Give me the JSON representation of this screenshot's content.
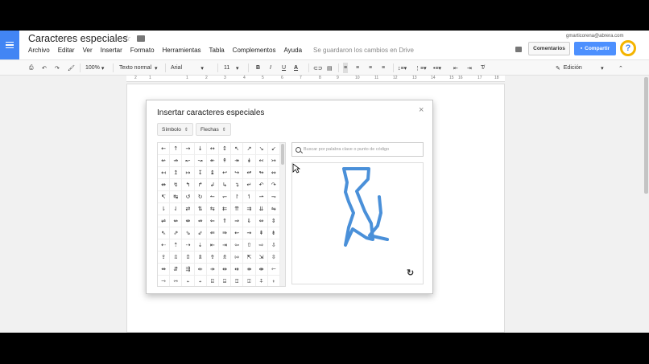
{
  "app": {
    "doc_title": "Caracteres especiales",
    "user_email": "gmarticorena@abrera.com",
    "save_status": "Se guardaron los cambios en Drive",
    "comments_label": "Comentarios",
    "share_label": "Compartir",
    "help_label": "?"
  },
  "menu": [
    "Archivo",
    "Editar",
    "Ver",
    "Insertar",
    "Formato",
    "Herramientas",
    "Tabla",
    "Complementos",
    "Ayuda"
  ],
  "toolbar": {
    "zoom": "100%",
    "style": "Texto normal",
    "font": "Arial",
    "size": "11",
    "bold": "B",
    "italic": "I",
    "underline": "U",
    "text_color": "A",
    "mode": "Edición"
  },
  "ruler": [
    "2",
    "1",
    "1",
    "2",
    "3",
    "4",
    "5",
    "6",
    "7",
    "8",
    "9",
    "10",
    "11",
    "12",
    "13",
    "14",
    "15",
    "16",
    "17",
    "18"
  ],
  "dialog": {
    "title": "Insertar caracteres especiales",
    "category": "Símbolo",
    "subcategory": "Flechas",
    "search_placeholder": "Buscar por palabra clave o punto de código",
    "close": "×",
    "undo": "↻"
  },
  "symbols": [
    [
      "←",
      "↑",
      "→",
      "↓",
      "↔",
      "↕",
      "↖",
      "↗",
      "↘",
      "↙"
    ],
    [
      "↚",
      "↛",
      "↜",
      "↝",
      "↞",
      "↟",
      "↠",
      "↡",
      "↢",
      "↣"
    ],
    [
      "↤",
      "↥",
      "↦",
      "↧",
      "↨",
      "↩",
      "↪",
      "↫",
      "↬",
      "↭"
    ],
    [
      "↮",
      "↯",
      "↰",
      "↱",
      "↲",
      "↳",
      "↴",
      "↵",
      "↶",
      "↷"
    ],
    [
      "↸",
      "↹",
      "↺",
      "↻",
      "↼",
      "↽",
      "↾",
      "↿",
      "⇀",
      "⇁"
    ],
    [
      "⇂",
      "⇃",
      "⇄",
      "⇅",
      "⇆",
      "⇇",
      "⇈",
      "⇉",
      "⇊",
      "⇋"
    ],
    [
      "⇌",
      "⇍",
      "⇎",
      "⇏",
      "⇐",
      "⇑",
      "⇒",
      "⇓",
      "⇔",
      "⇕"
    ],
    [
      "⇖",
      "⇗",
      "⇘",
      "⇙",
      "⇚",
      "⇛",
      "⇜",
      "⇝",
      "⇞",
      "⇟"
    ],
    [
      "⇠",
      "⇡",
      "⇢",
      "⇣",
      "⇤",
      "⇥",
      "⇦",
      "⇧",
      "⇨",
      "⇩"
    ],
    [
      "⇪",
      "⇫",
      "⇬",
      "⇭",
      "⇮",
      "⇯",
      "⇰",
      "⇱",
      "⇲",
      "⇳"
    ],
    [
      "⇴",
      "⇵",
      "⇶",
      "⇷",
      "⇸",
      "⇹",
      "⇺",
      "⇻",
      "⇼",
      "⇽"
    ],
    [
      "⇾",
      "⇿",
      "⍅",
      "⍆",
      "⍇",
      "⍈",
      "⍐",
      "⍗",
      "⍏",
      "⍖"
    ]
  ]
}
